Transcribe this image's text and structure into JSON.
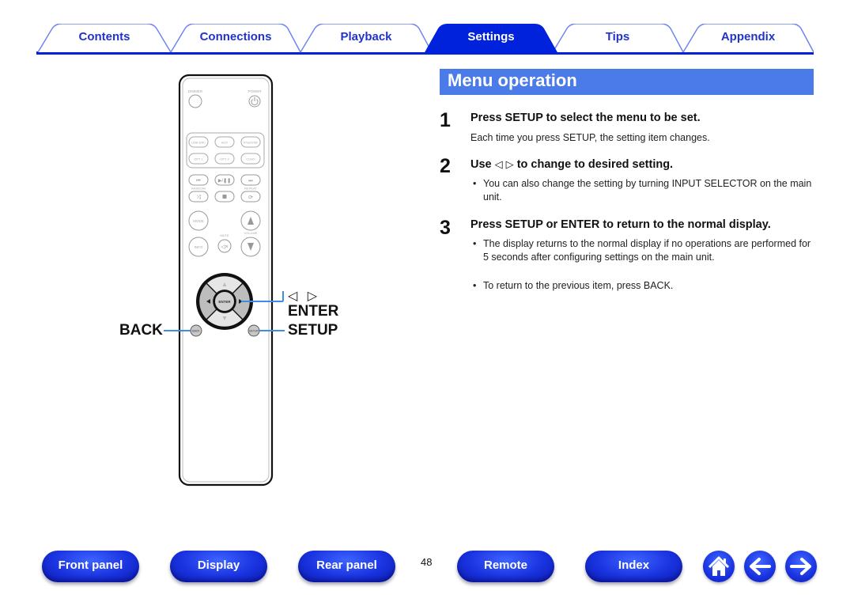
{
  "tabs": [
    {
      "label": "Contents",
      "active": false
    },
    {
      "label": "Connections",
      "active": false
    },
    {
      "label": "Playback",
      "active": false
    },
    {
      "label": "Settings",
      "active": true
    },
    {
      "label": "Tips",
      "active": false
    },
    {
      "label": "Appendix",
      "active": false
    }
  ],
  "colors": {
    "tab_blue": "#0022dd",
    "tab_outline": "#6f86f0",
    "title_bar": "#4a7be8",
    "callout_line": "#3a8ee6",
    "nav_button": "#1a33e0"
  },
  "section": {
    "title": "Menu operation",
    "steps": [
      {
        "number": "1",
        "heading": "Press SETUP to select the menu to be set.",
        "text": "Each time you press SETUP, the setting item changes."
      },
      {
        "number": "2",
        "heading_pre": "Use",
        "heading_left_icon": "◁",
        "heading_right_icon": "▷",
        "heading_post": "to change to desired setting.",
        "bullets": [
          "You can also change the setting by turning INPUT SELECTOR on the main unit."
        ]
      },
      {
        "number": "3",
        "heading": "Press SETUP or ENTER to return to the normal display.",
        "bullets": [
          "The display returns to the normal display if no operations are performed for 5 seconds after configuring settings on the main unit.",
          "To return to the previous item, press BACK."
        ]
      }
    ]
  },
  "remote": {
    "buttons": {
      "dimmer": "DIMMER",
      "power": "POWER",
      "usb_dac": "USB-DAC",
      "aux": "AUX",
      "ipod_usb": "iPod/USB",
      "opt1": "OPT 1",
      "opt2": "OPT 2",
      "coax": "COAX",
      "random": "RANDOM",
      "repeat": "REPEAT",
      "mode": "MODE",
      "info": "INFO",
      "mute": "MUTE",
      "volume": "VOLUME",
      "enter": "ENTER",
      "back": "BACK",
      "setup": "SETUP"
    },
    "callouts": {
      "arrows": "◁ ▷",
      "enter": "ENTER",
      "setup": "SETUP",
      "back": "BACK"
    }
  },
  "bottom_nav": {
    "buttons": [
      "Front panel",
      "Display",
      "Rear panel",
      "Remote",
      "Index"
    ],
    "page_number": "48",
    "icons": [
      "home-icon",
      "back-arrow-icon",
      "forward-arrow-icon"
    ]
  }
}
